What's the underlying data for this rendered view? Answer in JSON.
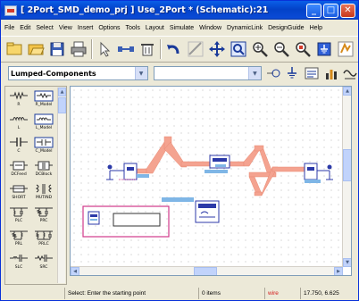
{
  "window": {
    "title": "[ 2Port_SMD_demo_prj ] Use_2Port * (Schematic):21",
    "minimize": "_",
    "maximize": "□",
    "close": "✕"
  },
  "menu": [
    "File",
    "Edit",
    "Select",
    "View",
    "Insert",
    "Options",
    "Tools",
    "Layout",
    "Simulate",
    "Window",
    "DynamicLink",
    "DesignGuide",
    "Help"
  ],
  "toolbar": {
    "icons": [
      "new-icon",
      "open-icon",
      "save-icon",
      "print-icon",
      "select-icon",
      "insert-wire-icon",
      "delete-icon",
      "undo-icon",
      "measure-icon",
      "move-icon",
      "zoom-area-icon",
      "zoom-in-icon",
      "zoom-out-icon",
      "zoom-fit-icon",
      "ground-icon",
      "simulate-icon"
    ]
  },
  "library": {
    "selected": "Lumped-Components",
    "component_value": ""
  },
  "palette": [
    [
      "R",
      "R_Model"
    ],
    [
      "L",
      "L_Model"
    ],
    [
      "C",
      "C_Model"
    ],
    [
      "DCFeed",
      "DCBlock"
    ],
    [
      "SHORT",
      "MUTIND"
    ],
    [
      "PLC",
      "PRC"
    ],
    [
      "PRL",
      "PRLC"
    ],
    [
      "SLC",
      "SRC"
    ]
  ],
  "status": {
    "prompt": "Select: Enter the starting point",
    "items": "0 items",
    "mode": "wire",
    "coords": "17.750, 6.625"
  },
  "colors": {
    "titlebar": "#0a4ad6",
    "trace": "#f4a390",
    "port": "#2c3aa8",
    "component_highlight": "#7fb6e6",
    "group_box": "#d03a8a"
  }
}
